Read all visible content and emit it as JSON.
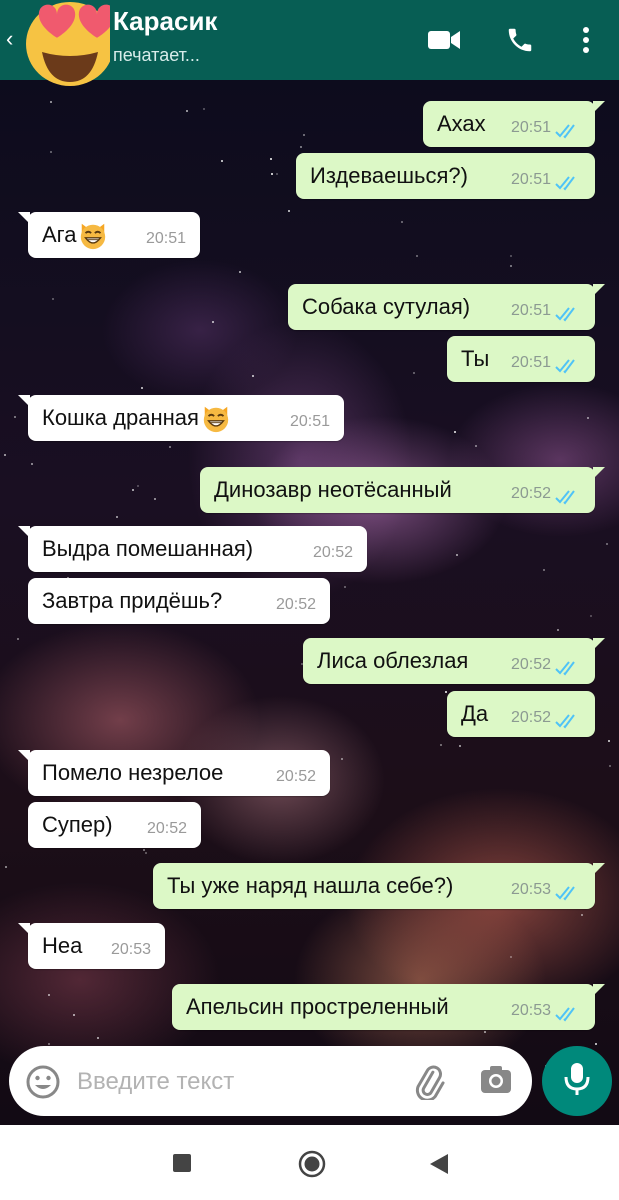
{
  "header": {
    "contact_name": "Карасик",
    "status": "печатает..."
  },
  "messages": [
    {
      "dir": "out",
      "text": "Ахах",
      "time": "20:51"
    },
    {
      "dir": "out",
      "text": "Издеваешься?)",
      "time": "20:51"
    },
    {
      "dir": "in",
      "text": "Ага",
      "emoji": "grinning-cat",
      "time": "20:51"
    },
    {
      "dir": "out",
      "text": "Собака сутулая)",
      "time": "20:51"
    },
    {
      "dir": "out",
      "text": "Ты",
      "time": "20:51"
    },
    {
      "dir": "in",
      "text": "Кошка дранная",
      "emoji": "grinning-cat",
      "time": "20:51"
    },
    {
      "dir": "out",
      "text": "Динозавр неотёсанный",
      "time": "20:52"
    },
    {
      "dir": "in",
      "text": "Выдра помешанная)",
      "time": "20:52"
    },
    {
      "dir": "in",
      "text": "Завтра придёшь?",
      "time": "20:52"
    },
    {
      "dir": "out",
      "text": "Лиса облезлая",
      "time": "20:52"
    },
    {
      "dir": "out",
      "text": "Да",
      "time": "20:52"
    },
    {
      "dir": "in",
      "text": "Помело незрелое",
      "time": "20:52"
    },
    {
      "dir": "in",
      "text": "Супер)",
      "time": "20:52"
    },
    {
      "dir": "out",
      "text": "Ты уже наряд нашла себе?)",
      "time": "20:53"
    },
    {
      "dir": "in",
      "text": "Неа",
      "time": "20:53"
    },
    {
      "dir": "out",
      "text": "Апельсин простреленный",
      "time": "20:53"
    }
  ],
  "input": {
    "placeholder": "Введите текст"
  },
  "colors": {
    "header": "#075e54",
    "outgoing_bubble": "#dcf8c6",
    "incoming_bubble": "#ffffff",
    "read_ticks": "#4fc3f7",
    "mic_button": "#00897b"
  },
  "icons": [
    "back-arrow-icon",
    "heart-eyes-emoji-avatar",
    "video-call-icon",
    "phone-icon",
    "more-vert-icon",
    "double-check-icon",
    "grinning-cat-emoji",
    "emoji-icon",
    "attach-icon",
    "camera-icon",
    "mic-icon",
    "nav-square-icon",
    "nav-circle-icon",
    "nav-back-triangle-icon"
  ]
}
